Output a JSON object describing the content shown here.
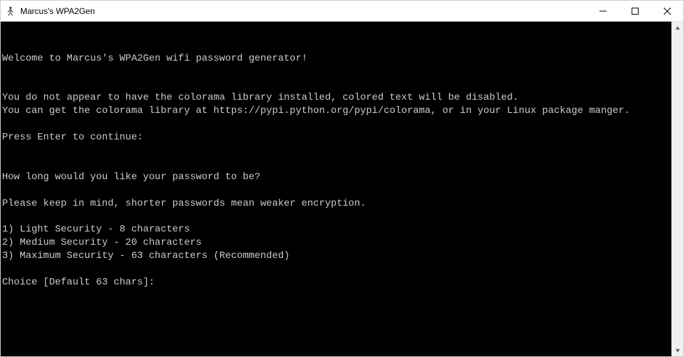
{
  "window": {
    "title": "Marcus's WPA2Gen"
  },
  "terminal": {
    "lines": [
      "",
      "",
      "Welcome to Marcus's WPA2Gen wifi password generator!",
      "",
      "",
      "You do not appear to have the colorama library installed, colored text will be disabled.",
      "You can get the colorama library at https://pypi.python.org/pypi/colorama, or in your Linux package manger.",
      "",
      "Press Enter to continue:",
      "",
      "",
      "How long would you like your password to be?",
      "",
      "Please keep in mind, shorter passwords mean weaker encryption.",
      "",
      "1) Light Security - 8 characters",
      "2) Medium Security - 20 characters",
      "3) Maximum Security - 63 characters (Recommended)",
      "",
      "Choice [Default 63 chars]:"
    ]
  }
}
